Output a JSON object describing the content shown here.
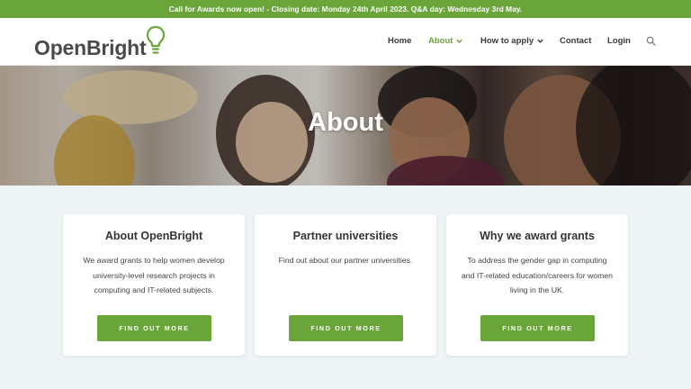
{
  "announcement": "Call for Awards now open! - Closing date: Monday 24th April 2023. Q&A day: Wednesday 3rd May.",
  "logo": {
    "text": "OpenBright"
  },
  "nav": [
    {
      "label": "Home",
      "active": false,
      "dropdown": false
    },
    {
      "label": "About",
      "active": true,
      "dropdown": true
    },
    {
      "label": "How to apply",
      "active": false,
      "dropdown": true
    },
    {
      "label": "Contact",
      "active": false,
      "dropdown": false
    },
    {
      "label": "Login",
      "active": false,
      "dropdown": false
    }
  ],
  "hero": {
    "title": "About"
  },
  "cards": [
    {
      "title": "About OpenBright",
      "body": "We award grants to help women develop university-level research projects in computing and IT-related subjects.",
      "button": "FIND OUT MORE"
    },
    {
      "title": "Partner universities",
      "body": "Find out about our partner universities.",
      "button": "FIND OUT MORE"
    },
    {
      "title": "Why we award grants",
      "body": "To address the gender gap in computing and IT-related education/careers for women living in the UK.",
      "button": "FIND OUT MORE"
    }
  ],
  "colors": {
    "brand_green": "#6aa53a",
    "text_dark": "#3a3a3a",
    "page_bg": "#eef4f5"
  },
  "icons": {
    "search": "search-icon",
    "dropdown": "chevron-down-icon",
    "logo": "lightbulb-icon"
  }
}
